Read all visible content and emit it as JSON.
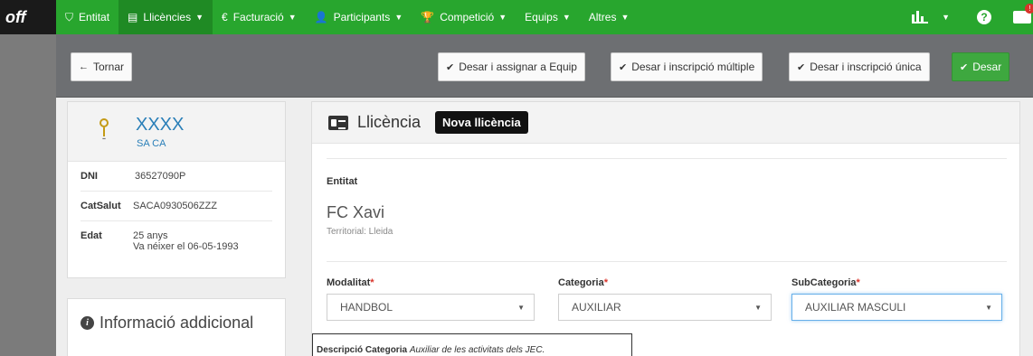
{
  "nav": {
    "brand": "off",
    "items": [
      {
        "label": "Entitat",
        "icon": "shield-icon",
        "glyph": "⛉",
        "caret": false,
        "active": false
      },
      {
        "label": "Llicències",
        "icon": "id-card-icon",
        "glyph": "▤",
        "caret": true,
        "active": true
      },
      {
        "label": "Facturació",
        "icon": "euro-icon",
        "glyph": "€",
        "caret": true,
        "active": false
      },
      {
        "label": "Participants",
        "icon": "user-icon",
        "glyph": "👤",
        "caret": true,
        "active": false
      },
      {
        "label": "Competició",
        "icon": "trophy-icon",
        "glyph": "🏆",
        "caret": true,
        "active": false
      },
      {
        "label": "Equips",
        "icon": "",
        "glyph": "",
        "caret": true,
        "active": false
      },
      {
        "label": "Altres",
        "icon": "",
        "glyph": "",
        "caret": true,
        "active": false
      }
    ],
    "help_glyph": "?",
    "mail_badge": "!"
  },
  "toolbar": {
    "back_label": "Tornar",
    "back_glyph": "←",
    "save_assign_label": "Desar i assignar a Equip",
    "save_multi_label": "Desar i inscripció múltiple",
    "save_single_label": "Desar i inscripció única",
    "save_label": "Desar",
    "check_glyph": "✔"
  },
  "profile": {
    "name": "XXXX",
    "subname": "SA CA",
    "rows": [
      {
        "label": "DNI",
        "value": "36527090P",
        "value2": ""
      },
      {
        "label": "CatSalut",
        "value": "SACA0930506ZZZ",
        "value2": ""
      },
      {
        "label": "Edat",
        "value": "25 anys",
        "value2": "Va néixer el 06-05-1993"
      }
    ]
  },
  "additional_info": {
    "title": "Informació addicional"
  },
  "license": {
    "title": "Llicència",
    "badge": "Nova llicència",
    "entitat_label": "Entitat",
    "entitat_name": "FC Xavi",
    "entitat_sub": "Territorial: Lleida",
    "modalitat_label": "Modalitat",
    "modalitat_value": "HANDBOL",
    "categoria_label": "Categoria",
    "categoria_value": "AUXILIAR",
    "subcategoria_label": "SubCategoria",
    "subcategoria_value": "AUXILIAR MASCULI",
    "required_mark": "*",
    "desc_label": "Descripció Categoria",
    "desc_text": "Auxiliar de les activitats dels JEC."
  }
}
